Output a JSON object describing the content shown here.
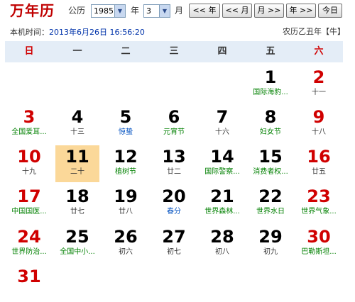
{
  "app": {
    "title": "万年历"
  },
  "toolbar": {
    "calendar_label": "公历",
    "year_value": "1985",
    "year_suffix": "年",
    "month_value": "3",
    "month_suffix": "月",
    "prev_year_label": "<< 年",
    "prev_month_label": "<< 月",
    "next_month_label": "月 >>",
    "next_year_label": "年 >>",
    "today_label": "今日"
  },
  "status": {
    "clock_label": "本机时间：",
    "clock_value": "2013年6月26日 16:56:20",
    "lunar_year": "农历乙丑年【牛】"
  },
  "weekdays": [
    "日",
    "一",
    "二",
    "三",
    "四",
    "五",
    "六"
  ],
  "today_day": 11,
  "colors": {
    "red": "#d00000",
    "festival_green": "#008000",
    "solar_term_blue": "#0050c0",
    "today_bg": "#fbd899",
    "header_bg": "#e4edf7"
  },
  "days": [
    {
      "day": "1",
      "sub": "国际海豹...",
      "kind": "fest"
    },
    {
      "day": "2",
      "sub": "十一",
      "kind": "lunar"
    },
    {
      "day": "3",
      "sub": "全国爱耳...",
      "kind": "fest"
    },
    {
      "day": "4",
      "sub": "十三",
      "kind": "lunar"
    },
    {
      "day": "5",
      "sub": "惊蛰",
      "kind": "term"
    },
    {
      "day": "6",
      "sub": "元宵节",
      "kind": "fest"
    },
    {
      "day": "7",
      "sub": "十六",
      "kind": "lunar"
    },
    {
      "day": "8",
      "sub": "妇女节",
      "kind": "fest"
    },
    {
      "day": "9",
      "sub": "十八",
      "kind": "lunar"
    },
    {
      "day": "10",
      "sub": "十九",
      "kind": "lunar"
    },
    {
      "day": "11",
      "sub": "二十",
      "kind": "lunar"
    },
    {
      "day": "12",
      "sub": "植树节",
      "kind": "fest"
    },
    {
      "day": "13",
      "sub": "廿二",
      "kind": "lunar"
    },
    {
      "day": "14",
      "sub": "国际警察...",
      "kind": "fest"
    },
    {
      "day": "15",
      "sub": "消费者权...",
      "kind": "fest"
    },
    {
      "day": "16",
      "sub": "廿五",
      "kind": "lunar"
    },
    {
      "day": "17",
      "sub": "中国国医...",
      "kind": "fest"
    },
    {
      "day": "18",
      "sub": "廿七",
      "kind": "lunar"
    },
    {
      "day": "19",
      "sub": "廿八",
      "kind": "lunar"
    },
    {
      "day": "20",
      "sub": "春分",
      "kind": "term"
    },
    {
      "day": "21",
      "sub": "世界森林...",
      "kind": "fest"
    },
    {
      "day": "22",
      "sub": "世界水日",
      "kind": "fest"
    },
    {
      "day": "23",
      "sub": "世界气象...",
      "kind": "fest"
    },
    {
      "day": "24",
      "sub": "世界防治...",
      "kind": "fest"
    },
    {
      "day": "25",
      "sub": "全国中小...",
      "kind": "fest"
    },
    {
      "day": "26",
      "sub": "初六",
      "kind": "lunar"
    },
    {
      "day": "27",
      "sub": "初七",
      "kind": "lunar"
    },
    {
      "day": "28",
      "sub": "初八",
      "kind": "lunar"
    },
    {
      "day": "29",
      "sub": "初九",
      "kind": "lunar"
    },
    {
      "day": "30",
      "sub": "巴勒斯坦...",
      "kind": "fest"
    },
    {
      "day": "31",
      "sub": "",
      "kind": "lunar"
    }
  ]
}
